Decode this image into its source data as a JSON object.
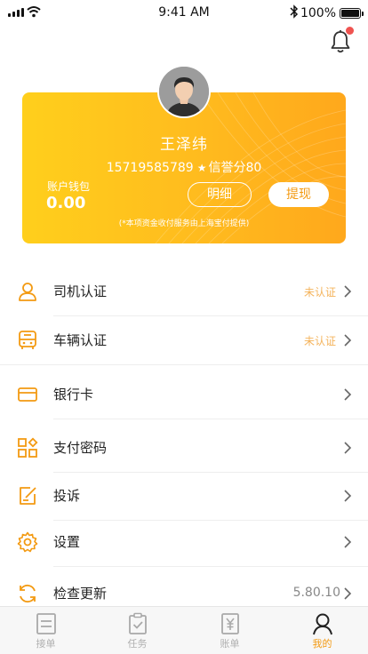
{
  "status_bar": {
    "time": "9:41 AM",
    "battery_percent": "100%",
    "battery_level": 1.0
  },
  "notifications": {
    "has_unread": true
  },
  "profile": {
    "name": "王泽纬",
    "phone": "15719585789",
    "credit_label": "信誉分80",
    "wallet_label": "账户钱包",
    "wallet_value": "0.00",
    "detail_button": "明细",
    "withdraw_button": "提现",
    "note": "(*本项资金收付服务由上海宝付提供)"
  },
  "colors": {
    "accent": "#f39a12",
    "card_start": "#ffcf1c",
    "card_end": "#ffa81c",
    "status_text": "#f4b35b",
    "badge": "#ef5350"
  },
  "menu": {
    "items": [
      {
        "icon": "driver-icon",
        "label": "司机认证",
        "status": "未认证"
      },
      {
        "icon": "vehicle-icon",
        "label": "车辆认证",
        "status": "未认证"
      },
      {
        "icon": "bank-card-icon",
        "label": "银行卡"
      },
      {
        "icon": "payment-password-icon",
        "label": "支付密码"
      },
      {
        "icon": "complaint-icon",
        "label": "投诉"
      },
      {
        "icon": "settings-icon",
        "label": "设置"
      },
      {
        "icon": "refresh-icon",
        "label": "检查更新",
        "version": "5.80.10"
      }
    ]
  },
  "tabbar": {
    "tabs": [
      {
        "icon": "order-list-icon",
        "label": "接单"
      },
      {
        "icon": "task-clipboard-icon",
        "label": "任务"
      },
      {
        "icon": "bill-yen-icon",
        "label": "账单"
      },
      {
        "icon": "profile-icon",
        "label": "我的",
        "active": true
      }
    ]
  }
}
